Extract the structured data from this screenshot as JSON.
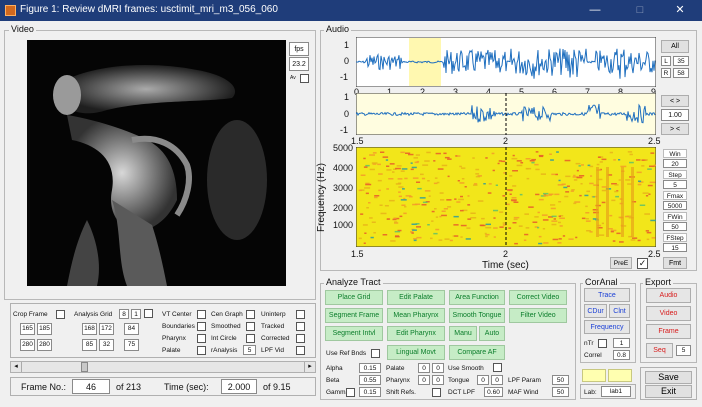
{
  "window": {
    "title": "Figure 1: Review dMRI frames: usctimit_mri_m3_056_060",
    "minimize": "—",
    "maximize": "□",
    "close": "✕"
  },
  "video": {
    "title": "Video",
    "fps_label": "fps",
    "fps_value": "23.2",
    "av_label": "Av",
    "crop_frame_label": "Crop Frame",
    "crop_vals": [
      "165",
      "185",
      "280",
      "280"
    ],
    "analysis_grid_label": "Analysis Grid",
    "grid_a": "8",
    "grid_b": "1",
    "grid_vals": [
      "168",
      "172",
      "84",
      "85",
      "32",
      "75"
    ],
    "checks": [
      [
        "VT Center",
        "Cen Graph",
        "Uninterp"
      ],
      [
        "Boundaries",
        "Smoothed",
        "Tracked"
      ],
      [
        "Pharynx",
        "Int Circle",
        "Corrected"
      ],
      [
        "Palate",
        "rAnalysis",
        "LPF Vid"
      ]
    ],
    "ranalysis_value": "5",
    "frame_label": "Frame No.:",
    "frame_value": "46",
    "frame_of": "of 213",
    "time_label": "Time (sec):",
    "time_value": "2.000",
    "time_of": "of 9.15"
  },
  "audio": {
    "title": "Audio",
    "top": {
      "yticks": [
        "1",
        "0",
        "-1"
      ],
      "xticks": [
        "0",
        "1",
        "2",
        "3",
        "4",
        "5",
        "6",
        "7",
        "8",
        "9"
      ]
    },
    "mid": {
      "yticks": [
        "1",
        "0",
        "-1"
      ],
      "xticks": [
        "1.5",
        "2",
        "2.5"
      ]
    },
    "spec": {
      "ylabel": "Frequency (Hz)",
      "yticks": [
        "5000",
        "4000",
        "3000",
        "2000",
        "1000"
      ],
      "xticks": [
        "1.5",
        "2",
        "2.5"
      ],
      "xlabel": "Time (sec)"
    },
    "side": {
      "all": "All",
      "L": "L",
      "L_val": "35",
      "R": "R",
      "R_val": "58",
      "zoom": "< >",
      "zoom_val": "1.00",
      "shift": "> <",
      "win": "Win",
      "win_val": "20",
      "step": "Step",
      "step_val": "5",
      "fmax": "Fmax",
      "fmax_val": "5000",
      "fwin": "FWin",
      "fwin_val": "50",
      "fstep": "FStep",
      "fstep_val": "15",
      "fmt": "Fmt",
      "pre": "PreE"
    }
  },
  "analyze": {
    "title": "Analyze Tract",
    "row1": [
      "Place Grid",
      "Edit Palate",
      "Area Function",
      "Correct Video"
    ],
    "row2": [
      "Segment Frame",
      "Mean Pharynx",
      "Smooth Tongue",
      "Filter Video"
    ],
    "row3": [
      "Segment Intvl",
      "Edit Pharynx",
      "Manu",
      "Auto"
    ],
    "use_ref": "Use Ref Bnds",
    "lingual": "Lingual Movt",
    "compare": "Compare AF",
    "params": [
      [
        "Alpha",
        "0.15",
        "Palate",
        "0",
        "0",
        "Use Smooth"
      ],
      [
        "Beta",
        "0.55",
        "Pharynx",
        "0",
        "0",
        "Tongue",
        "0",
        "0",
        "LPF Param",
        "50"
      ],
      [
        "Gamma",
        "0.15",
        "Shift Refs.",
        "DCT LPF",
        "0.60",
        "MAF Wind",
        "50"
      ]
    ]
  },
  "coranal": {
    "title": "CorAnal",
    "trace": "Trace",
    "cdur": "CDur",
    "clnt": "Clnt",
    "frequency": "Frequency",
    "ntr": "nTr",
    "ntr_val": "1",
    "correl": "Correl",
    "correl_val": "0.8",
    "lab": "Lab:",
    "lab_val": "lab1"
  },
  "export": {
    "title": "Export",
    "audio": "Audio",
    "video": "Video",
    "frame": "Frame",
    "seq": "Seq",
    "seq_val": "5",
    "save": "Save",
    "exit": "Exit"
  },
  "colors": {
    "wave": "#1f6fbf",
    "highlight": "#fff8b0",
    "spec_bg": "#f2e61a",
    "title_bar": "#1f3d7a"
  }
}
